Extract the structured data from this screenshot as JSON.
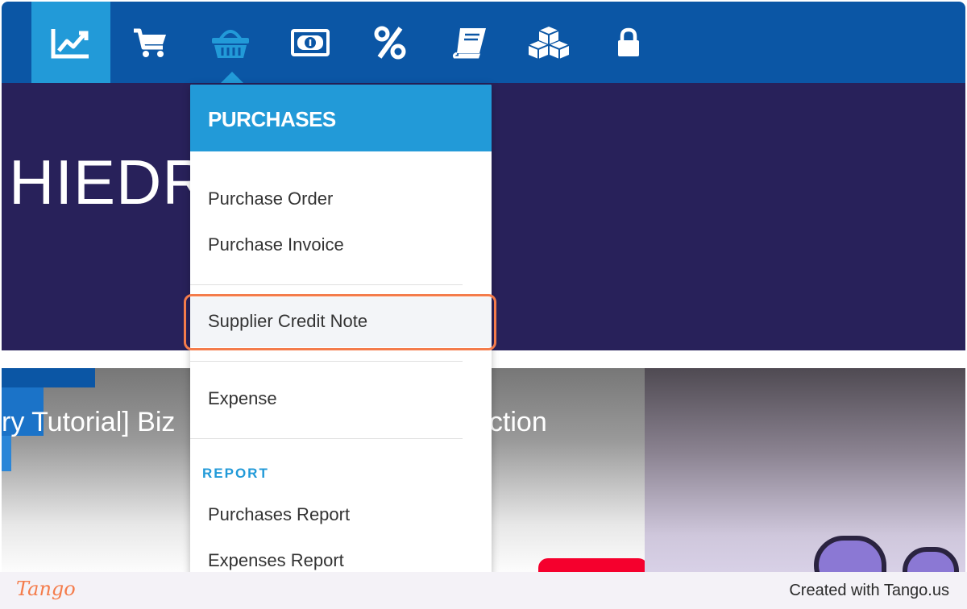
{
  "nav": {
    "items": [
      {
        "icon": "chart-line-icon",
        "active": true
      },
      {
        "icon": "shopping-cart-icon",
        "active": false
      },
      {
        "icon": "basket-icon",
        "active": false
      },
      {
        "icon": "money-bill-icon",
        "active": false
      },
      {
        "icon": "percent-icon",
        "active": false
      },
      {
        "icon": "book-icon",
        "active": false
      },
      {
        "icon": "cubes-icon",
        "active": false
      },
      {
        "icon": "lock-icon",
        "active": false
      }
    ],
    "bar_color": "#0b56a5",
    "active_color": "#229ad8"
  },
  "hero": {
    "title": "HIEDR",
    "background": "#28215a"
  },
  "video": {
    "title_part1": "ry Tutorial] Biz",
    "title_part2": "uction"
  },
  "dropdown": {
    "title": "PURCHASES",
    "items": [
      {
        "label": "Purchase Order"
      },
      {
        "label": "Purchase Invoice"
      },
      {
        "label": "Supplier Credit Note",
        "highlighted": true
      },
      {
        "label": "Expense"
      }
    ],
    "report_section": {
      "title": "REPORT",
      "items": [
        {
          "label": "Purchases Report"
        },
        {
          "label": "Expenses Report"
        }
      ]
    },
    "highlight_color": "#f47c4b"
  },
  "footer": {
    "logo": "Tango",
    "credit": "Created with Tango.us"
  }
}
